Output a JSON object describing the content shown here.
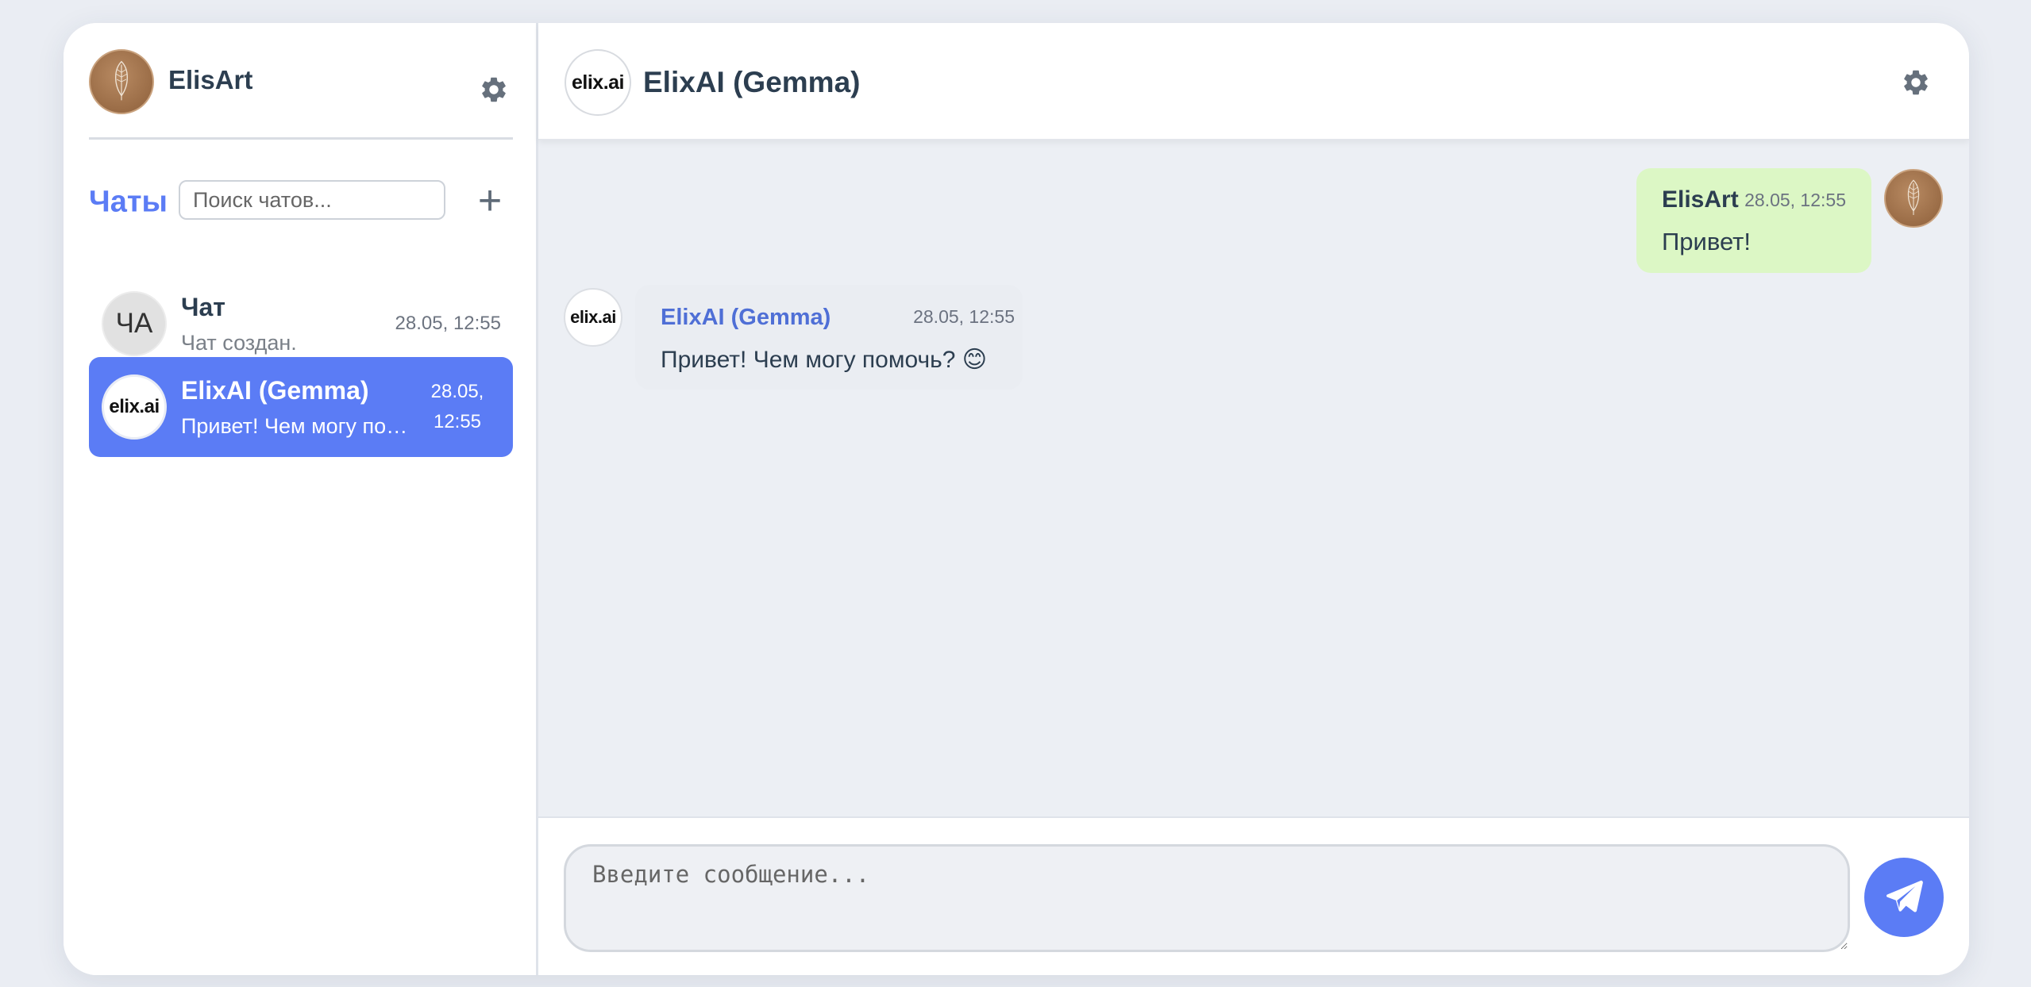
{
  "colors": {
    "accent": "#5b7cf5",
    "user_bubble": "#dcf7c5",
    "bot_name": "#4f6fd6",
    "background": "#eaedf3"
  },
  "profile": {
    "name": "ElisArt",
    "avatar_icon": "feather-avatar",
    "settings_icon": "gear-icon"
  },
  "sidebar": {
    "title": "Чаты",
    "search_placeholder": "Поиск чатов...",
    "add_label": "+",
    "chats": [
      {
        "avatar_text": "ЧА",
        "name": "Чат",
        "preview": "Чат создан.",
        "time": "28.05, 12:55",
        "active": false
      },
      {
        "avatar_text": "elix.ai",
        "name": "ElixAI (Gemma)",
        "preview": "Привет! Чем могу помочь? 😊",
        "time": "28.05, 12:55",
        "active": true
      }
    ]
  },
  "header": {
    "logo_text": "elix.ai",
    "title": "ElixAI (Gemma)",
    "settings_icon": "gear-icon"
  },
  "messages": [
    {
      "author": "ElisArt",
      "time": "28.05, 12:55",
      "text": "Привет!",
      "from": "user"
    },
    {
      "author": "ElixAI (Gemma)",
      "time": "28.05, 12:55",
      "text": "Привет! Чем могу помочь? 😊",
      "from": "bot",
      "avatar_text": "elix.ai"
    }
  ],
  "composer": {
    "placeholder": "Введите сообщение...",
    "send_icon": "paper-plane-icon"
  }
}
